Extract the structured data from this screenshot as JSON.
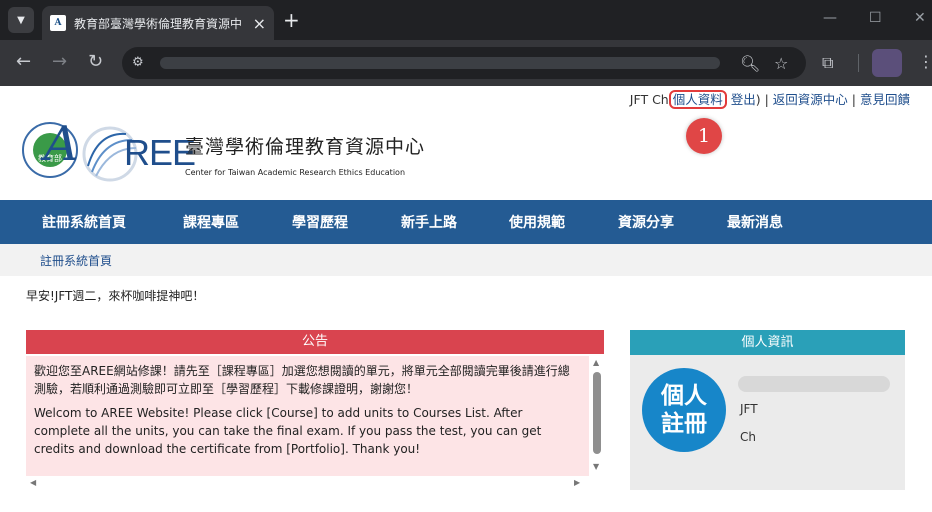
{
  "browser": {
    "tab_title": "教育部臺灣學術倫理教育資源中",
    "icons": [
      "tab-list-icon",
      "tab-favicon",
      "close-tab-icon",
      "new-tab-icon",
      "minimize-icon",
      "maximize-icon",
      "close-window-icon",
      "back-icon",
      "forward-icon",
      "reload-icon",
      "site-info-icon",
      "zoom-icon",
      "star-icon",
      "extensions-icon",
      "profile-avatar",
      "menu-icon"
    ]
  },
  "top_links": {
    "user": "JFT Ch",
    "profile": "個人資料",
    "logout": "登出",
    "paren_close": ")",
    "sep1": " | ",
    "back_center": "返回資源中心",
    "sep2": " | ",
    "feedback": "意見回饋"
  },
  "annotation": {
    "marker": "1",
    "color": "#e04646"
  },
  "logo": {
    "seal_text": "教育部",
    "aree_a": "A",
    "aree_ree": "REE",
    "center_title": "臺灣學術倫理教育資源中心",
    "center_sub": "Center for Taiwan Academic Research Ethics Education"
  },
  "nav": {
    "items": [
      "註冊系統首頁",
      "課程專區",
      "學習歷程",
      "新手上路",
      "使用規範",
      "資源分享",
      "最新消息"
    ],
    "color": "#245b93"
  },
  "breadcrumb": "註冊系統首頁",
  "greeting": "早安!JFT週二，來杯咖啡提神吧！",
  "announcement": {
    "title": "公告",
    "paragraph_zh": "歡迎您至AREE網站修課！請先至［課程專區］加選您想閱讀的單元，將單元全部閱讀完畢後請進行總測驗，若順利通過測驗即可立即至［學習歷程］下載修課證明，謝謝您！",
    "paragraph_en": "Welcom to AREE Website! Please click [Course] to add units to Courses List. After complete all the units, you can take the final exam.  If you pass the test, you can get credits and download the certificate from [Portfolio]. Thank you!",
    "header_color": "#d9444f"
  },
  "personal_info": {
    "title": "個人資訊",
    "register_line1": "個人",
    "register_line2": "註冊",
    "first_name": "JFT",
    "last_name": "Ch",
    "header_color": "#2aa0b8"
  }
}
